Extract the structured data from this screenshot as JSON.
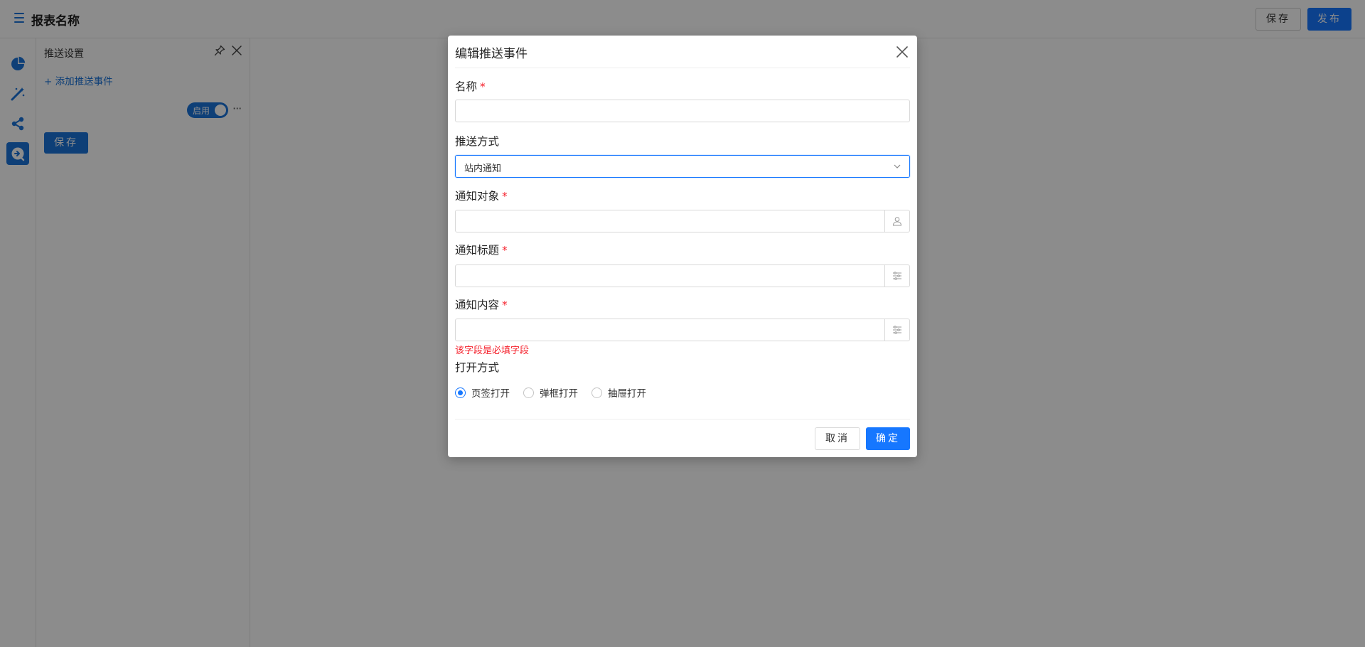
{
  "header": {
    "title": "报表名称",
    "save_label": "保存",
    "publish_label": "发布",
    "icons": [
      "menu-icon"
    ]
  },
  "rail": {
    "items": [
      {
        "icon": "pie-chart-icon"
      },
      {
        "icon": "magic-wand-icon"
      },
      {
        "icon": "share-icon"
      },
      {
        "icon": "push-event-icon",
        "active": true
      }
    ]
  },
  "panel": {
    "title": "推送设置",
    "add_link": "+ 添加推送事件",
    "switch_label": "启用",
    "more_label": "···",
    "save_label": "保存",
    "icons": [
      "pin-icon",
      "close-icon"
    ]
  },
  "modal": {
    "title": "编辑推送事件",
    "fields": {
      "name_label": "名称",
      "push_method_label": "推送方式",
      "push_method_value": "站内通知",
      "target_label": "通知对象",
      "notify_title_label": "通知标题",
      "notify_content_label": "通知内容",
      "content_error": "该字段是必填字段",
      "open_mode_label": "打开方式",
      "required_mark": "*"
    },
    "open_mode_options": [
      {
        "label": "页签打开",
        "checked": true
      },
      {
        "label": "弹框打开",
        "checked": false
      },
      {
        "label": "抽屉打开",
        "checked": false
      }
    ],
    "cancel_label": "取消",
    "ok_label": "确定"
  },
  "colors": {
    "primary": "#1677ff",
    "accent": "#1a73d9",
    "error": "#f5222d",
    "mask": "rgba(0,0,0,0.45)"
  }
}
